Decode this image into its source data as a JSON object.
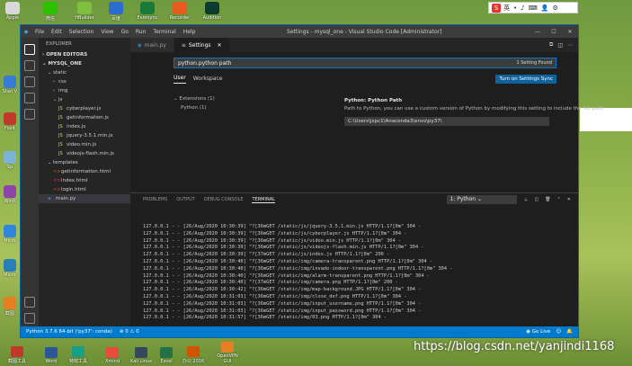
{
  "desktop": {
    "top_icons": [
      {
        "label": "Apple",
        "icon": "apple-app-icon",
        "color": "#d9d9d9"
      },
      {
        "label": "微信",
        "icon": "wechat-icon",
        "color": "#2dc100"
      },
      {
        "label": "HBuilder",
        "icon": "hbuilder-icon",
        "color": "#7fbf3f"
      },
      {
        "label": "百度",
        "icon": "browser-icon",
        "color": "#2d6dd2"
      },
      {
        "label": "Eversync",
        "icon": "sync-app-icon",
        "color": "#1a7a3a"
      },
      {
        "label": "Recorder",
        "icon": "recorder-icon",
        "color": "#e85d1f"
      },
      {
        "label": "Audition",
        "icon": "audition-icon",
        "color": "#0b3d2e"
      }
    ],
    "left_icons": [
      {
        "label": "Stan V",
        "icon": "stan-app-icon",
        "color": "#3a7bd5"
      },
      {
        "label": "Foxit",
        "icon": "foxit-icon",
        "color": "#c0392b"
      },
      {
        "label": "Sp",
        "icon": "sp-app-icon",
        "color": "#7fb3d5"
      },
      {
        "label": "WinR",
        "icon": "winrar-icon",
        "color": "#8e44ad"
      },
      {
        "label": "Micro",
        "icon": "microsoft-icon",
        "color": "#2e86de"
      },
      {
        "label": "Micro",
        "icon": "edge-icon",
        "color": "#2980b9"
      },
      {
        "label": "截图",
        "icon": "screenshot-icon",
        "color": "#e67e22"
      }
    ],
    "tray": {
      "logo": "S",
      "items": [
        "英",
        "•",
        "♪",
        "⌨",
        "👤",
        "⚙"
      ]
    },
    "watermark": "https://blog.csdn.net/yanjindi1168"
  },
  "window": {
    "title": "Settings - mysql_one - Visual Studio Code [Administrator]",
    "menu": [
      "File",
      "Edit",
      "Selection",
      "View",
      "Go",
      "Run",
      "Terminal",
      "Help"
    ],
    "controls": [
      "—",
      "☐",
      "✕"
    ]
  },
  "explorer": {
    "header": "EXPLORER",
    "open_editors": "OPEN EDITORS",
    "project": "MYSQL_ONE",
    "tree": [
      {
        "label": "static",
        "depth": 1,
        "kind": "folder-open"
      },
      {
        "label": "css",
        "depth": 2,
        "kind": "folder"
      },
      {
        "label": "img",
        "depth": 2,
        "kind": "folder"
      },
      {
        "label": "js",
        "depth": 2,
        "kind": "folder-open"
      },
      {
        "label": "cyberplayer.js",
        "depth": 3,
        "kind": "js"
      },
      {
        "label": "getinformation.js",
        "depth": 3,
        "kind": "js"
      },
      {
        "label": "index.js",
        "depth": 3,
        "kind": "js"
      },
      {
        "label": "jquery-3.5.1.min.js",
        "depth": 3,
        "kind": "js"
      },
      {
        "label": "video.min.js",
        "depth": 3,
        "kind": "js"
      },
      {
        "label": "videojs-flash.min.js",
        "depth": 3,
        "kind": "js"
      },
      {
        "label": "templates",
        "depth": 1,
        "kind": "folder-open"
      },
      {
        "label": "getinformation.html",
        "depth": 2,
        "kind": "html"
      },
      {
        "label": "index.html",
        "depth": 2,
        "kind": "html"
      },
      {
        "label": "login.html",
        "depth": 2,
        "kind": "html"
      },
      {
        "label": "main.py",
        "depth": 1,
        "kind": "py"
      }
    ]
  },
  "tabs": [
    {
      "label": "main.py",
      "active": false
    },
    {
      "label": "Settings",
      "active": true
    }
  ],
  "settings": {
    "search_value": "python.python path",
    "found": "1 Setting Found",
    "scopes": [
      "User",
      "Workspace"
    ],
    "sync_button": "Turn on Settings Sync",
    "tree": [
      "Extensions (1)",
      "Python (1)"
    ],
    "setting_title_prefix": "Python:",
    "setting_title": "Python Path",
    "setting_desc": "Path to Python, you can use a custom version of Python by modifying this setting to include the full path.",
    "setting_value": "C:\\Users\\jxpc1\\Anaconda3\\envs\\py37\\"
  },
  "panel": {
    "tabs": [
      "PROBLEMS",
      "OUTPUT",
      "DEBUG CONSOLE",
      "TERMINAL"
    ],
    "terminal_select": "1: Python",
    "log": [
      "127.0.0.1 - - [26/Aug/2020 10:30:39] \"?[36mGET /static/js/jquery-3.5.1.min.js HTTP/1.1?[0m\" 304 -",
      "127.0.0.1 - - [26/Aug/2020 10:30:39] \"?[36mGET /static/js/cyberplayer.js HTTP/1.1?[0m\" 304 -",
      "127.0.0.1 - - [26/Aug/2020 10:30:39] \"?[36mGET /static/js/video.min.js HTTP/1.1?[0m\" 304 -",
      "127.0.0.1 - - [26/Aug/2020 10:30:39] \"?[36mGET /static/js/videojs-flash.min.js HTTP/1.1?[0m\" 304 -",
      "127.0.0.1 - - [26/Aug/2020 10:30:39] \"?[37mGET /static/js/index.js HTTP/1.1?[0m\" 200 -",
      "127.0.0.1 - - [26/Aug/2020 10:30:40] \"?[36mGET /static/img/camera-transparent.png HTTP/1.1?[0m\" 304 -",
      "127.0.0.1 - - [26/Aug/2020 10:30:40] \"?[36mGET /static/img/invade-indoor-transparent.png HTTP/1.1?[0m\" 304 -",
      "127.0.0.1 - - [26/Aug/2020 10:30:40] \"?[36mGET /static/img/alarm-transparent.png HTTP/1.1?[0m\" 304 -",
      "127.0.0.1 - - [26/Aug/2020 10:30:40] \"?[37mGET /static/img/camera.png HTTP/1.1?[0m\" 200 -",
      "127.0.0.1 - - [26/Aug/2020 10:30:42] \"?[36mGET /static/img/map-background.JPG HTTP/1.1?[0m\" 304 -",
      "127.0.0.1 - - [26/Aug/2020 10:31:03] \"?[36mGET /static/img/close_def.png HTTP/1.1?[0m\" 304 -",
      "127.0.0.1 - - [26/Aug/2020 10:31:03] \"?[36mGET /static/img/input_username.png HTTP/1.1?[0m\" 304 -",
      "127.0.0.1 - - [26/Aug/2020 10:31:03] \"?[36mGET /static/img/input_password.png HTTP/1.1?[0m\" 304 -",
      "127.0.0.1 - - [26/Aug/2020 10:31:57] \"?[36mGET /static/img/03.png HTTP/1.1?[0m\" 304 -"
    ]
  },
  "statusbar": {
    "interpreter": "Python 3.7.6 64-bit ('py37': conda)",
    "problems": "⊗ 0 ⚠ 0",
    "go_live": "◉ Go Live"
  },
  "taskbar": [
    {
      "label": "截图工具",
      "icon": "snip-icon",
      "color": "#c0392b"
    },
    {
      "label": "Word",
      "icon": "word-icon",
      "color": "#2b579a"
    },
    {
      "label": "特效工具",
      "icon": "fx-icon",
      "color": "#16a085"
    },
    {
      "label": "Xmind",
      "icon": "xmind-icon",
      "color": "#e74c3c"
    },
    {
      "label": "Kali Linux",
      "icon": "kali-icon",
      "color": "#34495e"
    },
    {
      "label": "Excel",
      "icon": "excel-icon",
      "color": "#217346"
    },
    {
      "label": "办公 2016",
      "icon": "office-icon",
      "color": "#d35400"
    },
    {
      "label": "OpenVPN GUI",
      "icon": "openvpn-icon",
      "color": "#e67e22"
    }
  ]
}
